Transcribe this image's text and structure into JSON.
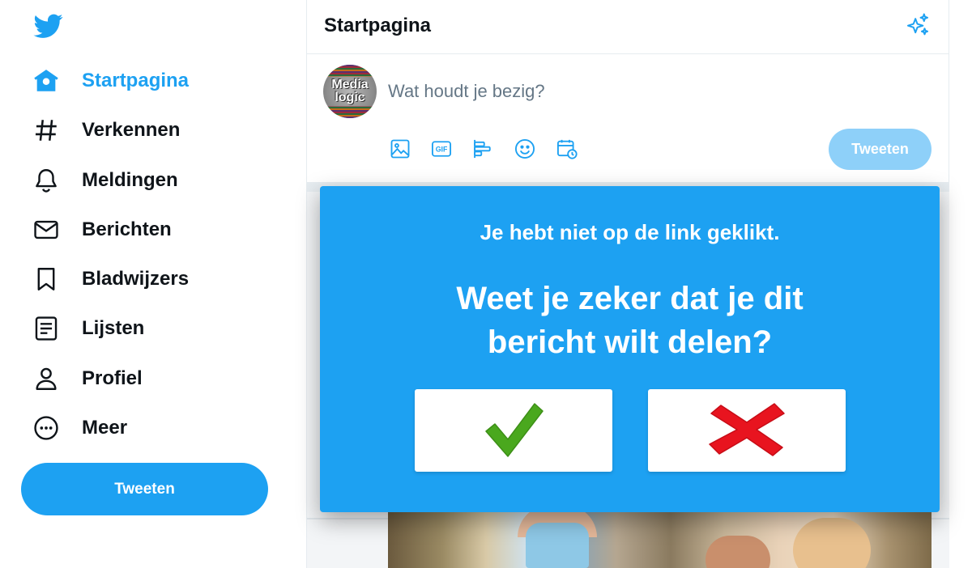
{
  "sidebar": {
    "logo_icon": "twitter-bird-icon",
    "items": [
      {
        "label": "Startpagina",
        "icon": "home-icon",
        "active": true
      },
      {
        "label": "Verkennen",
        "icon": "hashtag-icon",
        "active": false
      },
      {
        "label": "Meldingen",
        "icon": "bell-icon",
        "active": false
      },
      {
        "label": "Berichten",
        "icon": "envelope-icon",
        "active": false
      },
      {
        "label": "Bladwijzers",
        "icon": "bookmark-icon",
        "active": false
      },
      {
        "label": "Lijsten",
        "icon": "list-icon",
        "active": false
      },
      {
        "label": "Profiel",
        "icon": "person-icon",
        "active": false
      },
      {
        "label": "Meer",
        "icon": "more-icon",
        "active": false
      }
    ],
    "tweet_button": "Tweeten"
  },
  "header": {
    "title": "Startpagina",
    "sparkle_icon": "sparkle-icon"
  },
  "composer": {
    "avatar_text": "Media logic",
    "placeholder": "Wat houdt je bezig?",
    "tools": [
      "image-icon",
      "gif-icon",
      "poll-icon",
      "emoji-icon",
      "schedule-icon"
    ],
    "gif_label": "GIF",
    "tweet_button": "Tweeten"
  },
  "dialog": {
    "message": "Je hebt niet op de link geklikt.",
    "question": "Weet je zeker dat je dit bericht wilt delen?",
    "confirm_icon": "checkmark-icon",
    "cancel_icon": "cross-icon"
  },
  "colors": {
    "accent": "#1da1f2",
    "accent_disabled": "#8ed0f9",
    "confirm": "#4aa81e",
    "cancel": "#e8141f"
  }
}
